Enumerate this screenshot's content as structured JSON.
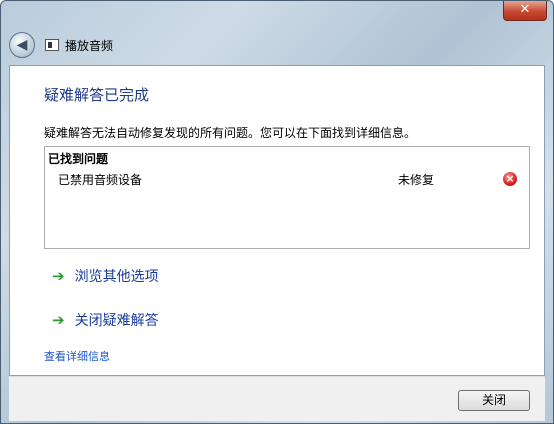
{
  "window": {
    "close_symbol": "✕"
  },
  "nav": {
    "title": "播放音频",
    "back_symbol": "◀"
  },
  "main": {
    "heading": "疑难解答已完成",
    "description": "疑难解答无法自动修复发现的所有问题。您可以在下面找到详细信息。",
    "problems_header": "已找到问题",
    "problems": [
      {
        "name": "已禁用音频设备",
        "status": "未修复",
        "icon": "error-icon"
      }
    ],
    "actions": [
      {
        "label": "浏览其他选项",
        "icon": "green-arrow-icon"
      },
      {
        "label": "关闭疑难解答",
        "icon": "green-arrow-icon"
      }
    ],
    "details_link": "查看详细信息"
  },
  "footer": {
    "close_button": "关闭"
  },
  "colors": {
    "heading": "#1e3a8a",
    "link": "#1a56c9",
    "arrow": "#2b9c2b",
    "error": "#d81f1f"
  }
}
